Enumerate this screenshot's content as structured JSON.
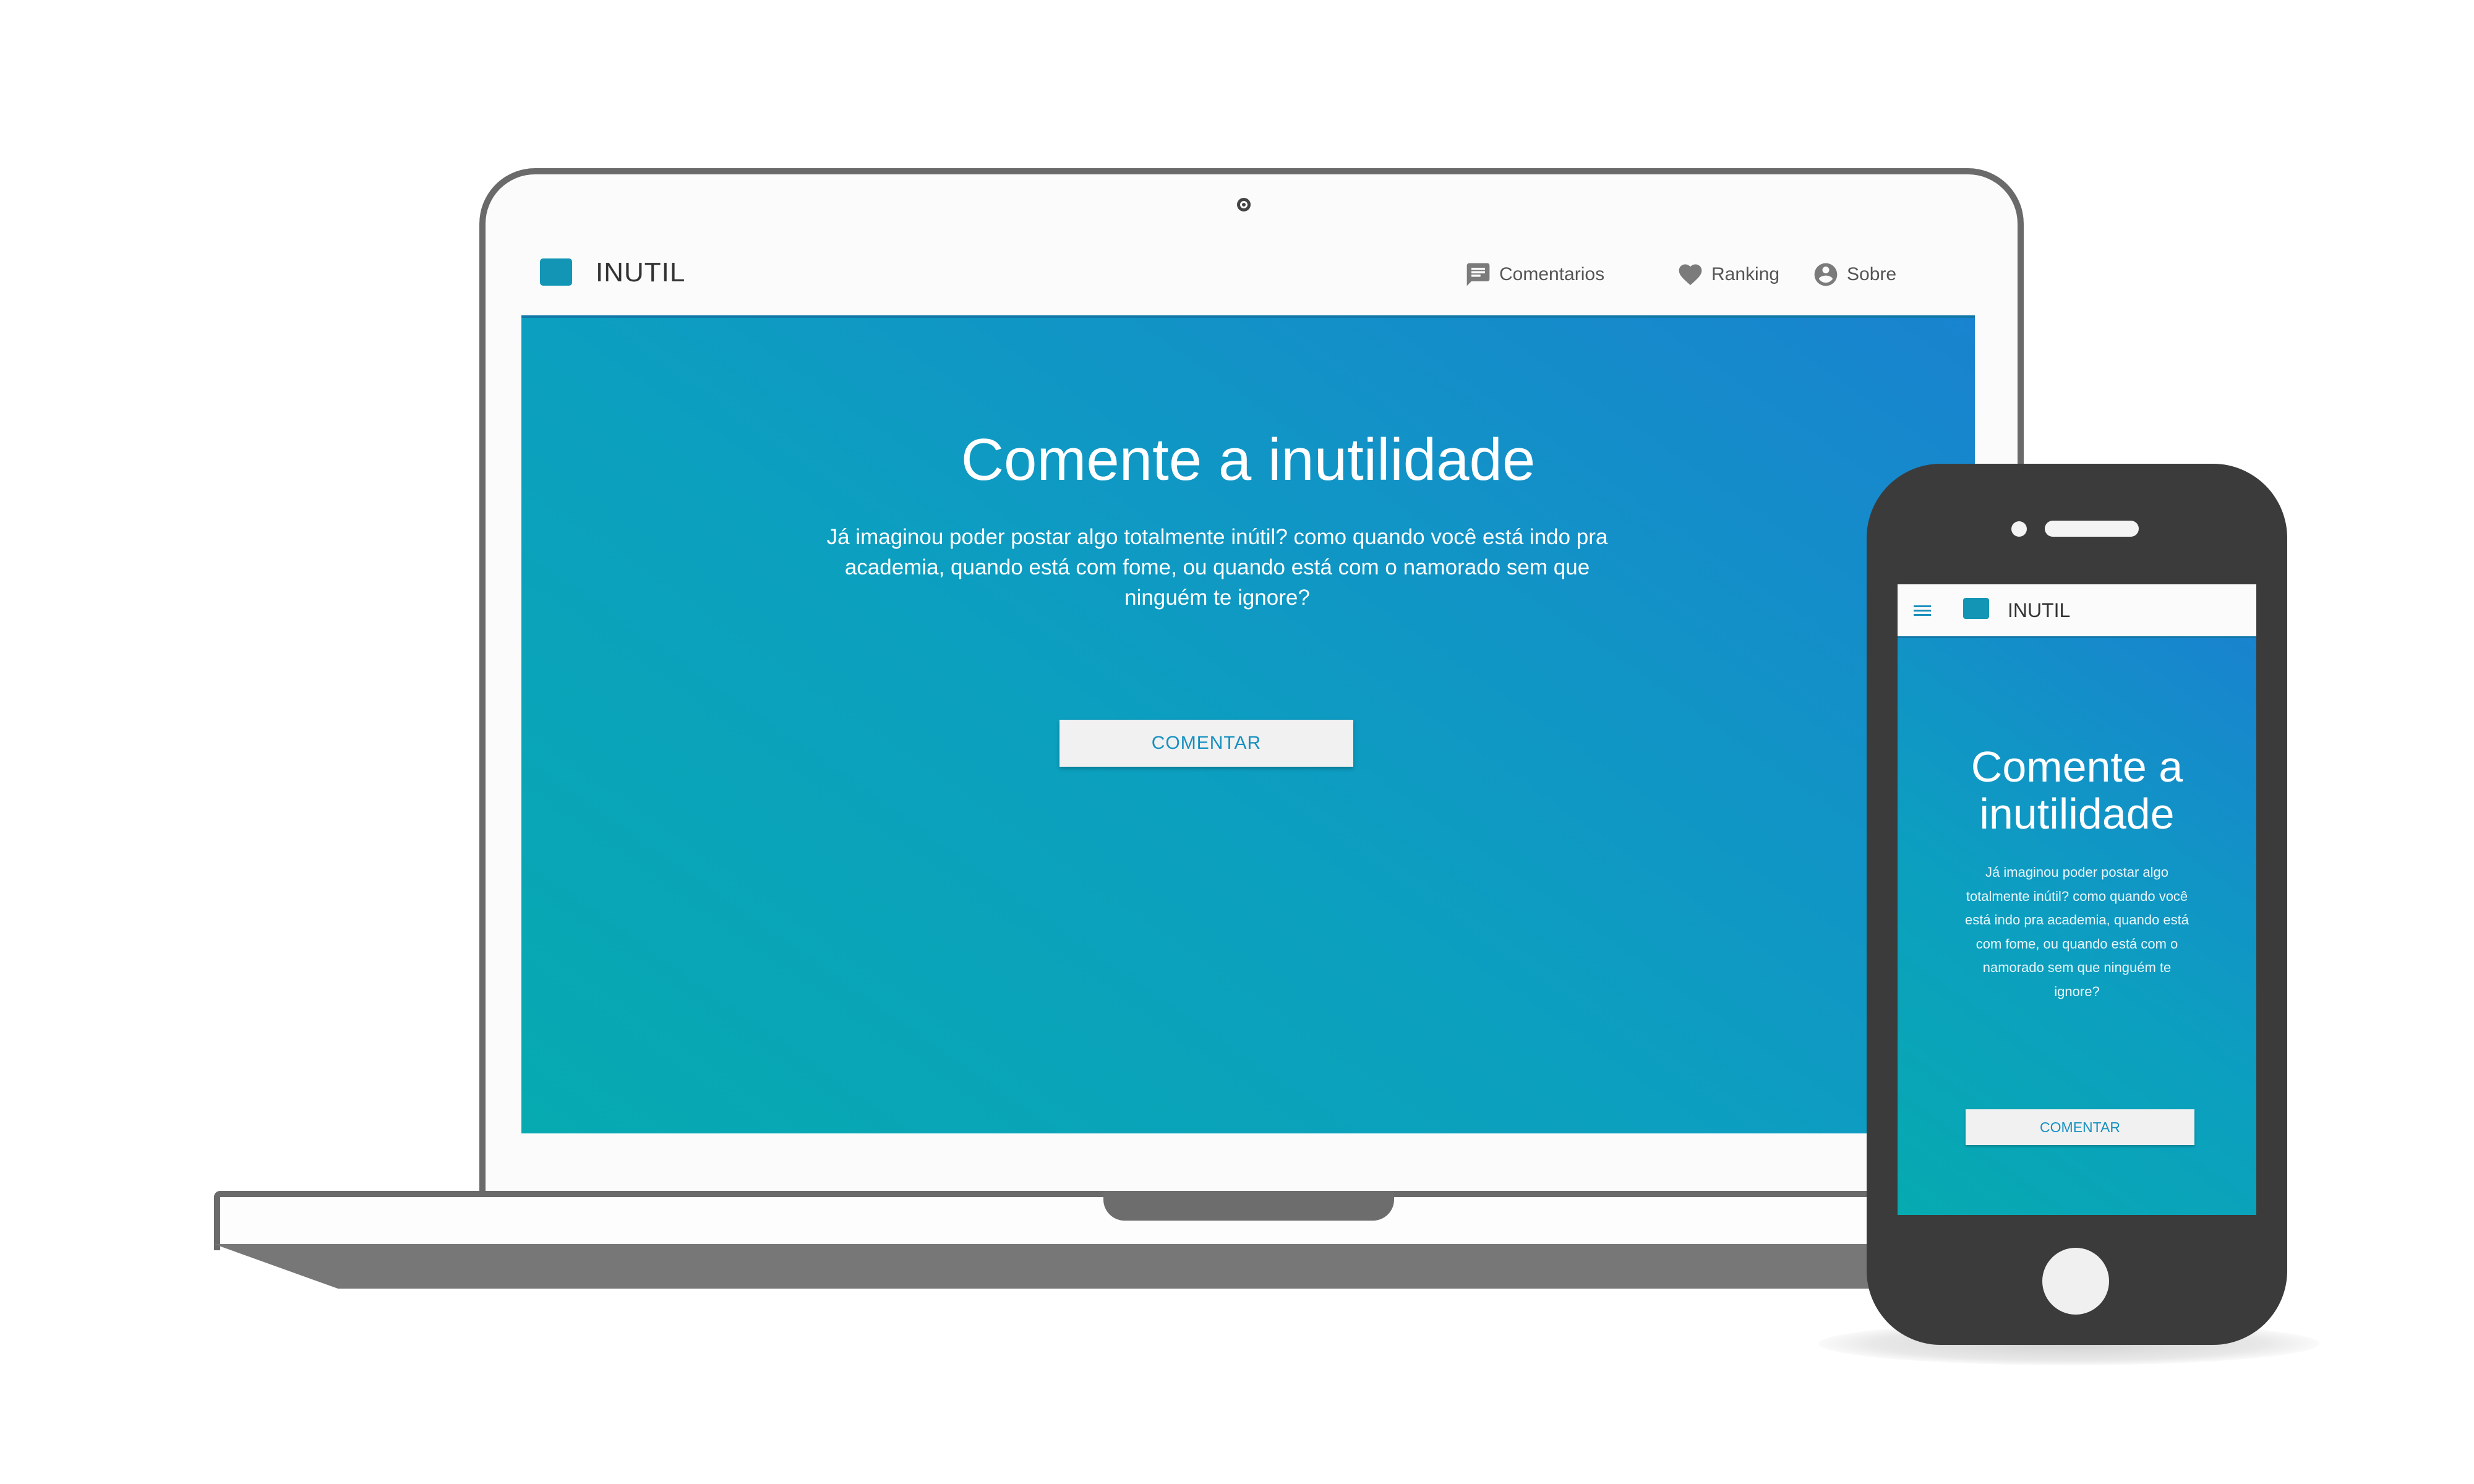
{
  "desktop": {
    "brand": "INUTIL",
    "nav": [
      {
        "label": "Comentarios",
        "icon": "comment-icon"
      },
      {
        "label": "Ranking",
        "icon": "heart-icon"
      },
      {
        "label": "Sobre",
        "icon": "account-circle-icon"
      }
    ],
    "hero": {
      "title": "Comente a inutilidade",
      "text": "Já imaginou poder postar algo totalmente inútil? como quando você está indo pra academia, quando está com fome, ou quando está com o namorado sem que ninguém te ignore?",
      "button": "COMENTAR"
    }
  },
  "mobile": {
    "brand": "INUTIL",
    "hero": {
      "title": "Comente a inutilidade",
      "text": "Já imaginou poder postar algo totalmente inútil? como quando você está indo pra academia, quando está com fome, ou quando está com o namorado sem que ninguém te ignore?",
      "button": "COMENTAR"
    }
  },
  "colors": {
    "accent": "#1396b6",
    "gradient_start": "#06aab0",
    "gradient_end": "#1983cf",
    "device_frame": "#6a6a6a"
  }
}
